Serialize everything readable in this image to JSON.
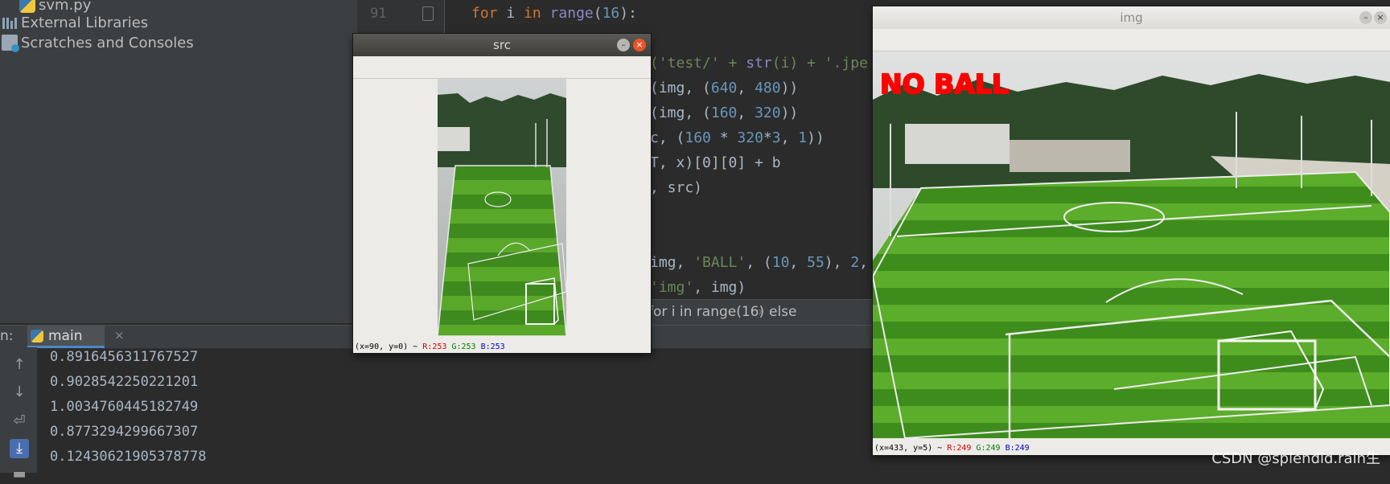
{
  "project_tree": {
    "file_item": "svm.py",
    "external_libraries": "External Libraries",
    "scratches": "Scratches and Consoles"
  },
  "editor": {
    "line_number": "91",
    "code_line_1": {
      "kw": "for",
      "var": " i ",
      "in": "in",
      "fn": " range",
      "open": "(",
      "num": "16",
      "close": "):"
    },
    "frag_1": {
      "a": "('test/' + ",
      "b": "str",
      "c": "(i) + '.jpe"
    },
    "frag_2": {
      "a": "(img, (",
      "n1": "640",
      "s": ", ",
      "n2": "480",
      "e": "))"
    },
    "frag_3": {
      "a": "(img, (",
      "n1": "160",
      "s": ", ",
      "n2": "320",
      "e": "))"
    },
    "frag_4": {
      "a": "c, (",
      "n1": "160",
      "m": " * ",
      "n2": "320",
      "m2": "*",
      "n3": "3",
      "s": ", ",
      "n4": "1",
      "e": "))"
    },
    "frag_5": "T, x)[0][0] + b",
    "frag_6": ", src)",
    "frag_7": {
      "a": "img, ",
      "str": "'BALL'",
      "b": ", (",
      "n1": "10",
      "s": ", ",
      "n2": "55",
      "c": "), ",
      "n3": "2",
      "d": ","
    },
    "frag_8": {
      "str": "'img'",
      "b": ", img)"
    }
  },
  "breadcrumb": {
    "item1": "for i in range(16)",
    "sep": "›",
    "item2": "else"
  },
  "run_panel": {
    "label": "n:",
    "tab": "main",
    "tab_close": "×",
    "outputs": [
      "0.8916456311767527",
      "0.9028542250221201",
      "1.0034760445182749",
      "0.8773294299667307",
      "0.12430621905378778"
    ]
  },
  "src_window": {
    "title": "src",
    "status": {
      "coords": "(x=90, y=0) ~ ",
      "r": "R:253",
      "g": "G:253",
      "b": "B:253"
    }
  },
  "img_window": {
    "title": "img",
    "overlay_text": "NO BALL",
    "status": {
      "coords": "(x=433, y=5) ~ ",
      "r": "R:249",
      "g": "G:249",
      "b": "B:249"
    }
  },
  "watermark": "CSDN @splendid.rain生",
  "colors": {
    "overlay_text": "#ff0000",
    "accent": "#4a88c7"
  }
}
